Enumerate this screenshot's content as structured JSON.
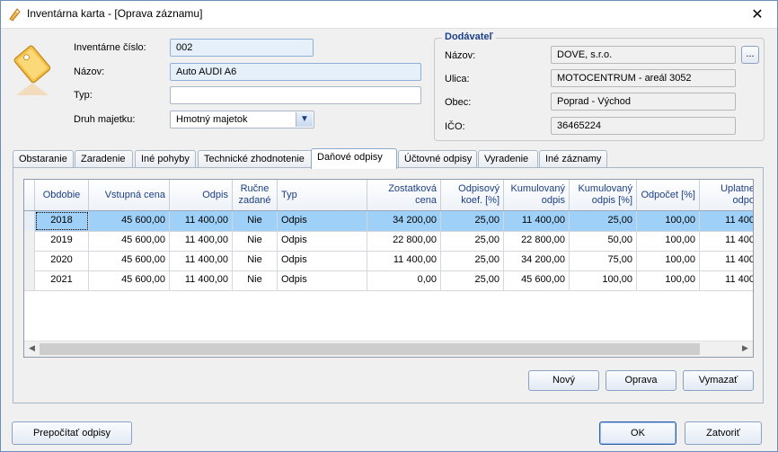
{
  "window": {
    "title": "Inventárna karta - [Oprava záznamu]",
    "close_glyph": "✕"
  },
  "form": {
    "inventory_number_label": "Inventárne číslo:",
    "inventory_number_value": "002",
    "name_label": "Názov:",
    "name_value": "Auto AUDI A6",
    "type_label": "Typ:",
    "type_value": "",
    "asset_kind_label": "Druh majetku:",
    "asset_kind_value": "Hmotný majetok"
  },
  "supplier": {
    "group_title": "Dodávateľ",
    "name_label": "Názov:",
    "name_value": "DOVE, s.r.o.",
    "browse_label": "...",
    "street_label": "Ulica:",
    "street_value": "MOTOCENTRUM - areál 3052",
    "city_label": "Obec:",
    "city_value": "Poprad - Východ",
    "ico_label": "IČO:",
    "ico_value": "36465224"
  },
  "tabs": [
    "Obstaranie",
    "Zaradenie",
    "Iné pohyby",
    "Technické zhodnotenie",
    "Daňové odpisy",
    "Účtovné odpisy",
    "Vyradenie",
    "Iné záznamy"
  ],
  "active_tab": "Daňové odpisy",
  "grid": {
    "headers": [
      "Obdobie",
      "Vstupná cena",
      "Odpis",
      "Ručne zadané",
      "Typ",
      "Zostatková cena",
      "Odpisový koef. [%]",
      "Kumulovaný odpis",
      "Kumulovaný odpis [%]",
      "Odpočet [%]",
      "Uplatne odpo"
    ],
    "rows": [
      [
        "2018",
        "45 600,00",
        "11 400,00",
        "Nie",
        "Odpis",
        "34 200,00",
        "25,00",
        "11 400,00",
        "25,00",
        "100,00",
        "11 400"
      ],
      [
        "2019",
        "45 600,00",
        "11 400,00",
        "Nie",
        "Odpis",
        "22 800,00",
        "25,00",
        "22 800,00",
        "50,00",
        "100,00",
        "11 400"
      ],
      [
        "2020",
        "45 600,00",
        "11 400,00",
        "Nie",
        "Odpis",
        "11 400,00",
        "25,00",
        "34 200,00",
        "75,00",
        "100,00",
        "11 400"
      ],
      [
        "2021",
        "45 600,00",
        "11 400,00",
        "Nie",
        "Odpis",
        "0,00",
        "25,00",
        "45 600,00",
        "100,00",
        "100,00",
        "11 400"
      ]
    ],
    "selected_row": 0
  },
  "buttons": {
    "new": "Nový",
    "edit": "Oprava",
    "delete": "Vymazať",
    "recalc": "Prepočítať odpisy",
    "ok": "OK",
    "close": "Zatvoriť"
  },
  "colors": {
    "selected_row": "#9fd0f7",
    "header_text": "#1b3f86",
    "group_title": "#1a3f8a"
  }
}
